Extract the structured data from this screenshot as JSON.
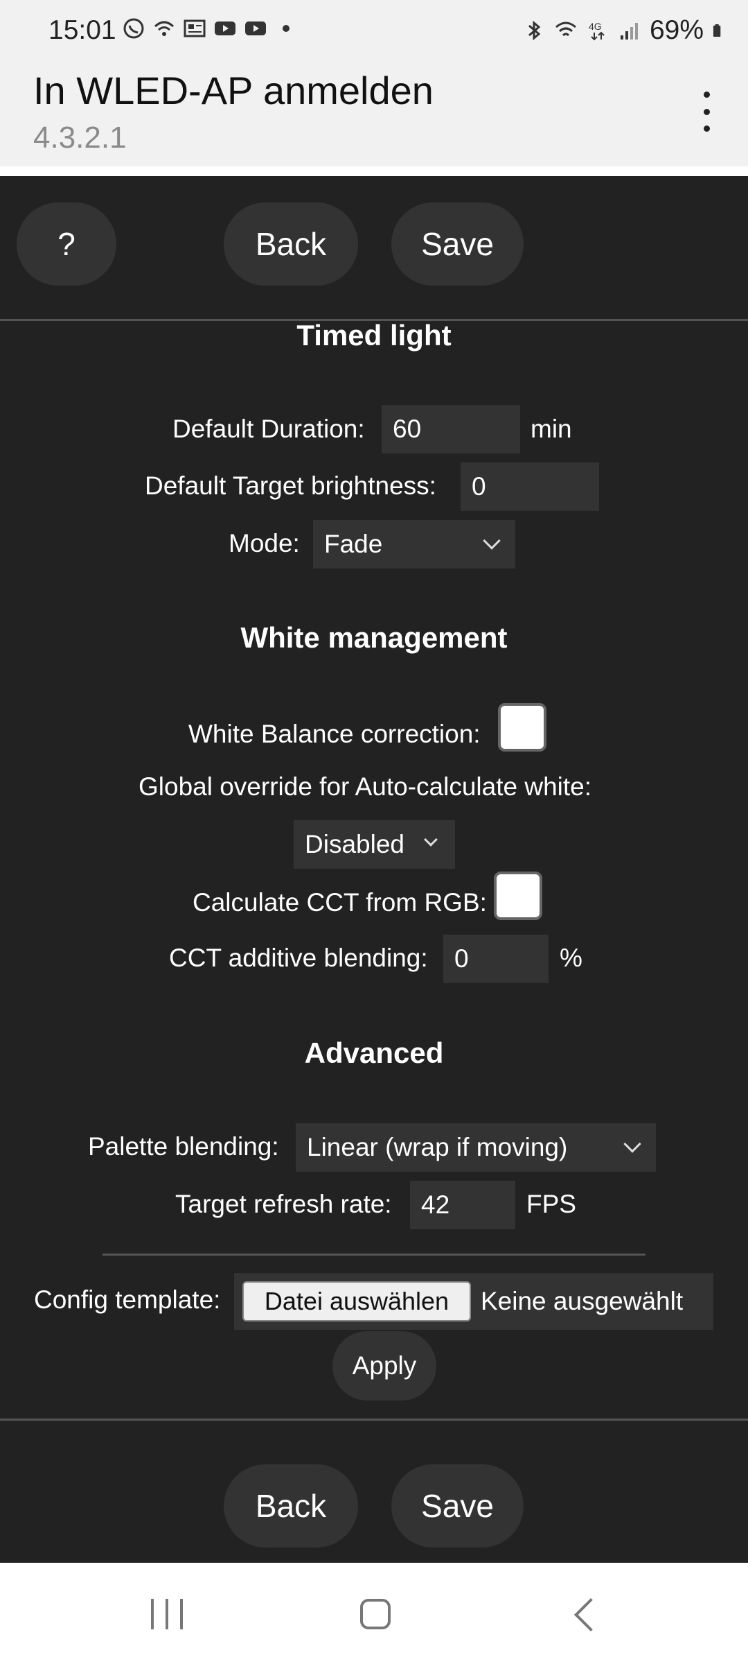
{
  "status_bar": {
    "time": "15:01",
    "battery": "69%",
    "network": "4G"
  },
  "app_bar": {
    "title": "In WLED-AP anmelden",
    "subtitle": "4.3.2.1"
  },
  "top_buttons": {
    "help": "?",
    "back": "Back",
    "save": "Save"
  },
  "timed_light": {
    "heading": "Timed light",
    "default_duration_label": "Default Duration:",
    "default_duration_value": "60",
    "default_duration_unit": "min",
    "target_brightness_label": "Default Target brightness:",
    "target_brightness_value": "0",
    "mode_label": "Mode:",
    "mode_value": "Fade"
  },
  "white_management": {
    "heading": "White management",
    "wb_correction_label": "White Balance correction:",
    "auto_white_label": "Global override for Auto-calculate white:",
    "auto_white_value": "Disabled",
    "cct_from_rgb_label": "Calculate CCT from RGB:",
    "cct_blending_label": "CCT additive blending:",
    "cct_blending_value": "0",
    "cct_blending_unit": "%"
  },
  "advanced": {
    "heading": "Advanced",
    "palette_blending_label": "Palette blending:",
    "palette_blending_value": "Linear (wrap if moving)",
    "refresh_rate_label": "Target refresh rate:",
    "refresh_rate_value": "42",
    "refresh_rate_unit": "FPS",
    "config_template_label": "Config template:",
    "choose_file_label": "Datei auswählen",
    "no_file_text": "Keine ausgewählt",
    "apply_label": "Apply"
  },
  "bottom_buttons": {
    "back": "Back",
    "save": "Save"
  }
}
